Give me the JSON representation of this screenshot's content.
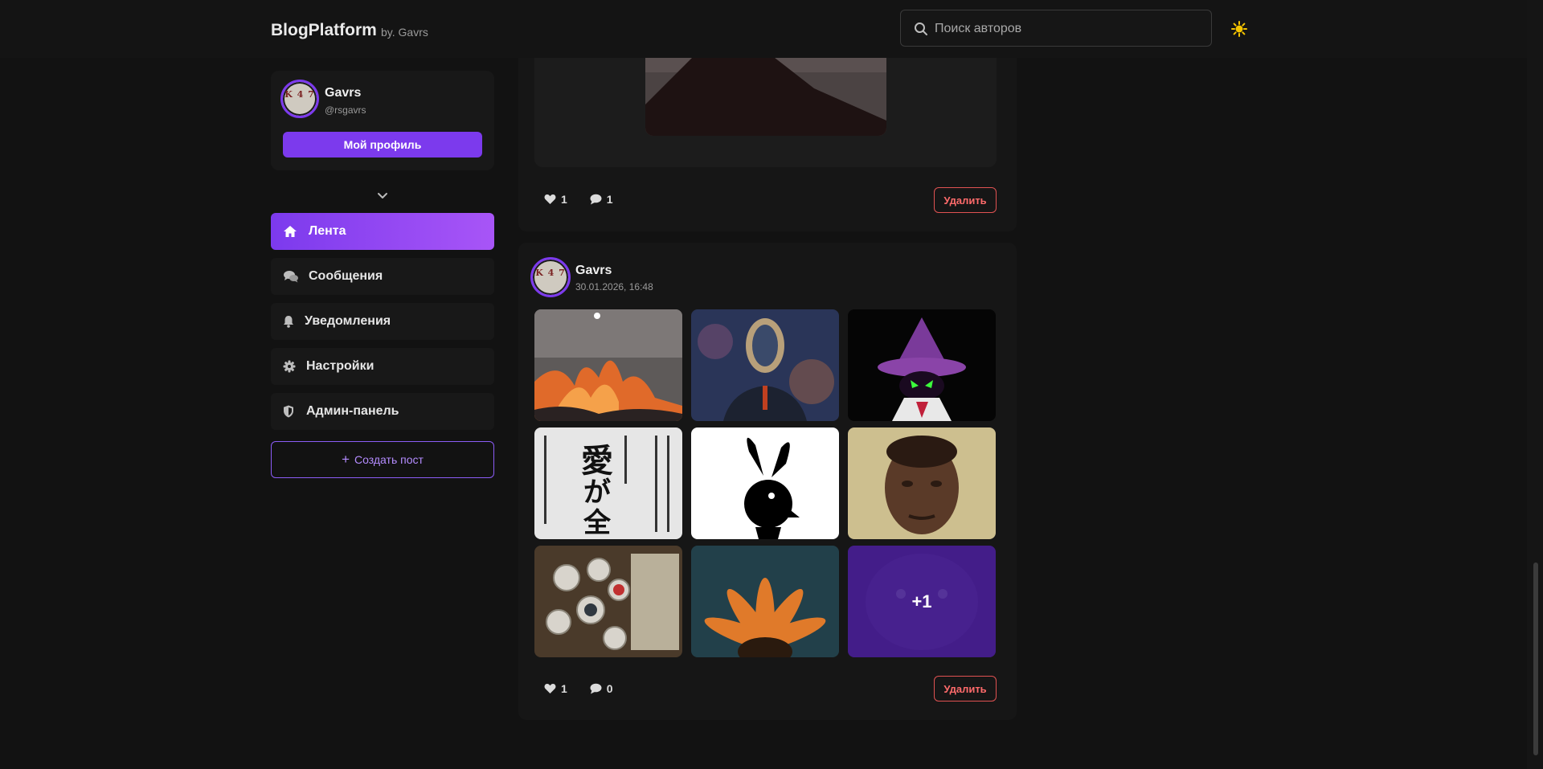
{
  "header": {
    "brand": "BlogPlatform",
    "brand_by": "by. Gavrs",
    "search_placeholder": "Поиск авторов",
    "theme_icon": "sun-icon",
    "colors": {
      "accent": "#7c3aed",
      "accent_light": "#a855f7",
      "danger": "#e05252",
      "sun": "#f5c400"
    }
  },
  "profile": {
    "name": "Gavrs",
    "handle": "@rsgavrs",
    "button_label": "Мой профиль",
    "avatar_text": "K 4 7"
  },
  "sidebar": {
    "items": [
      {
        "label": "Лента",
        "icon": "home-icon",
        "active": true
      },
      {
        "label": "Сообщения",
        "icon": "chat-bubbles-icon",
        "active": false
      },
      {
        "label": "Уведомления",
        "icon": "bell-icon",
        "active": false
      },
      {
        "label": "Настройки",
        "icon": "gear-icon",
        "active": false
      },
      {
        "label": "Админ-панель",
        "icon": "shield-icon",
        "active": false
      }
    ],
    "create_label": "Создать пост"
  },
  "posts": [
    {
      "likes": "1",
      "comments": "1",
      "delete_label": "Удалить"
    },
    {
      "author": "Gavrs",
      "date": "30.01.2026, 16:48",
      "likes": "1",
      "comments": "0",
      "delete_label": "Удалить",
      "images": [
        {
          "subject": "fire and smoke at night"
        },
        {
          "subject": "figure with glass head in space"
        },
        {
          "subject": "purple wizard hat with green face"
        },
        {
          "subject": "japanese text poster"
        },
        {
          "subject": "black bunny logo"
        },
        {
          "subject": "man portrait"
        },
        {
          "subject": "watches and money"
        },
        {
          "subject": "orange flower"
        },
        {
          "subject": "purple cat"
        }
      ],
      "more_label": "+1"
    }
  ]
}
